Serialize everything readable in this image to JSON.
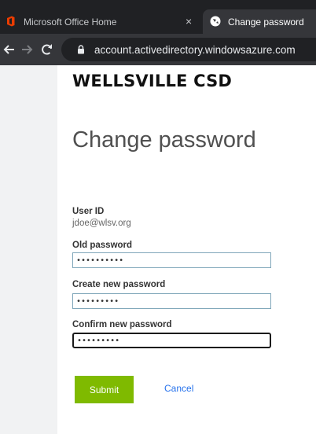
{
  "browser": {
    "tabs": [
      {
        "title": "Microsoft Office Home",
        "close": "×"
      },
      {
        "title": "Change password"
      }
    ],
    "address": "account.activedirectory.windowsazure.com"
  },
  "org": {
    "name": "WELLSVILLE CSD"
  },
  "form": {
    "title": "Change password",
    "userid_label": "User ID",
    "userid_value": "jdoe@wlsv.org",
    "old_label": "Old password",
    "old_value": "••••••••••",
    "new_label": "Create new password",
    "new_value": "•••••••••",
    "confirm_label": "Confirm new password",
    "confirm_value": "•••••••••",
    "submit_label": "Submit",
    "cancel_label": "Cancel"
  },
  "colors": {
    "submit": "#7fba00",
    "link": "#2672ec",
    "input_border": "#7fa6b9",
    "office_icon": "#eb3c00"
  },
  "icons": {
    "office": "office-logo-icon",
    "globe": "globe-icon",
    "back": "arrow-left-icon",
    "forward": "arrow-right-icon",
    "reload": "reload-icon",
    "lock": "lock-icon"
  }
}
